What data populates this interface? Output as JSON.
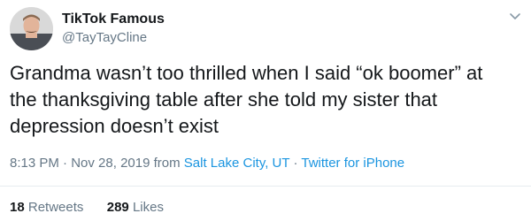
{
  "author": {
    "display_name": "TikTok Famous",
    "handle": "@TayTayCline"
  },
  "tweet": {
    "text": "Grandma wasn’t too thrilled when I said “ok boomer” at\nthe thanksgiving table after she told my sister that\ndepression doesn’t exist",
    "time": "8:13 PM",
    "date": "Nov 28, 2019",
    "from_label": "from",
    "location": "Salt Lake City, UT",
    "separator": "·",
    "source": "Twitter for iPhone"
  },
  "stats": {
    "retweets_count": "18",
    "retweets_label": "Retweets",
    "likes_count": "289",
    "likes_label": "Likes"
  },
  "colors": {
    "text": "#14171a",
    "secondary": "#657786",
    "link": "#1b95e0",
    "divider": "#e6ecf0"
  },
  "icons": {
    "menu": "chevron-down-icon"
  }
}
